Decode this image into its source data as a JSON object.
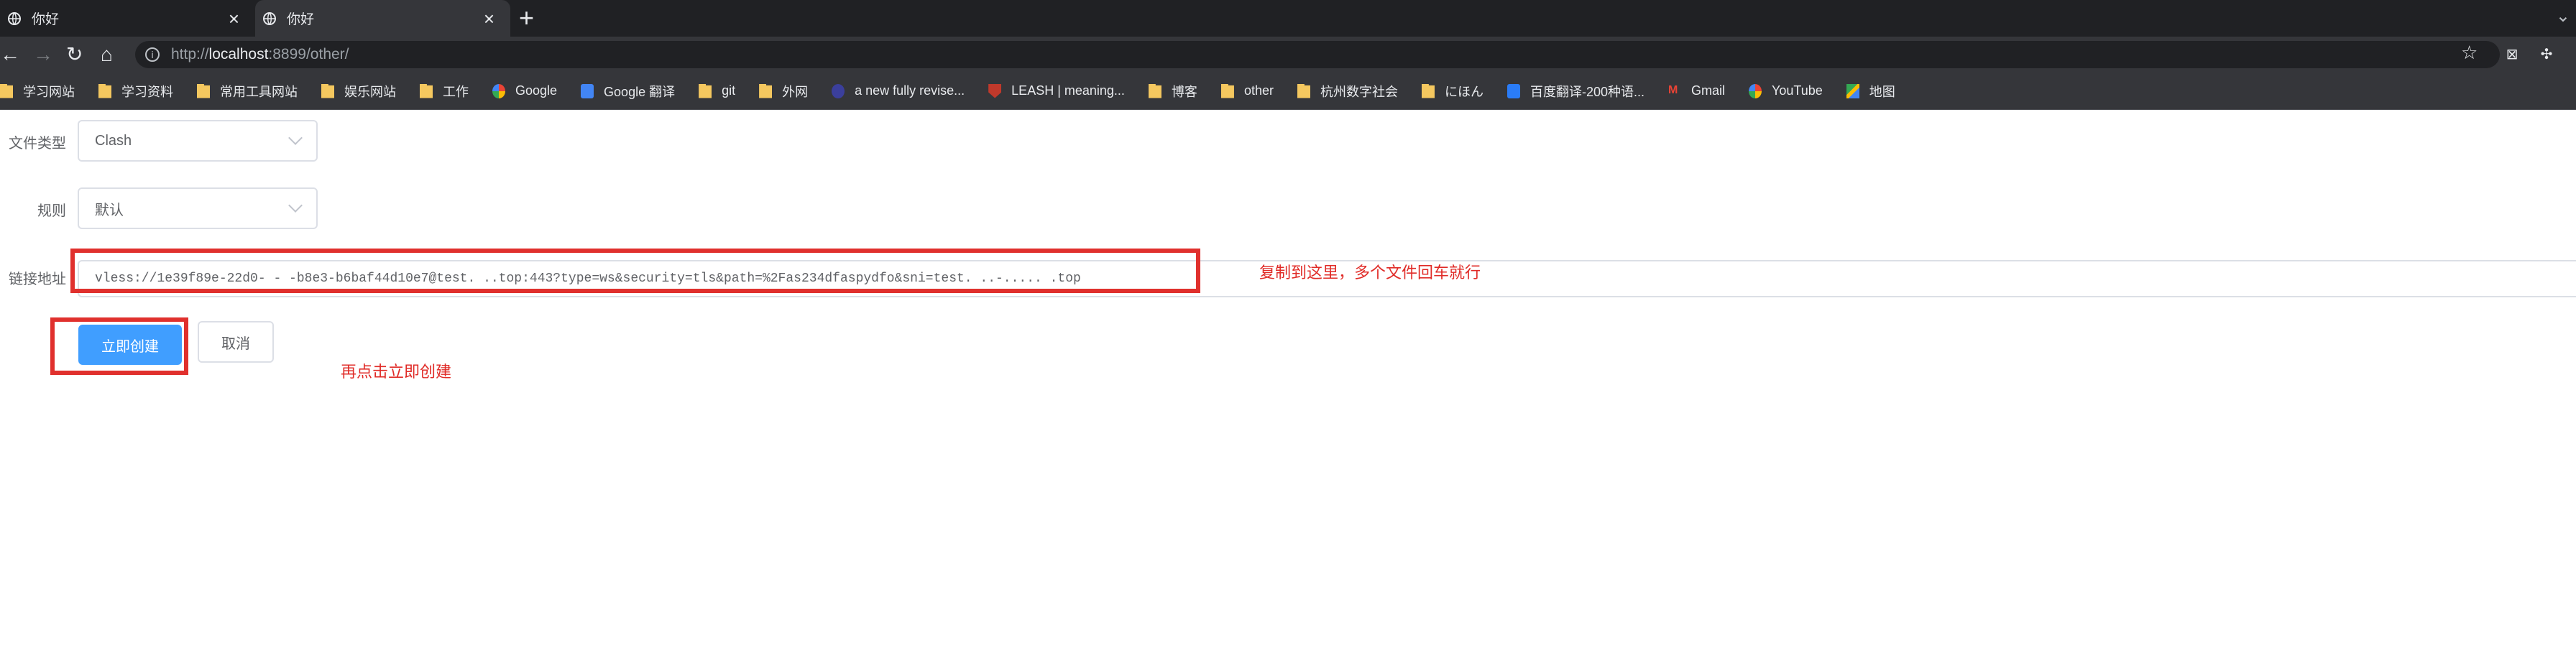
{
  "browser": {
    "tabs": [
      {
        "title": "你好",
        "active": false
      },
      {
        "title": "你好",
        "active": true
      }
    ],
    "url_prefix": "http://",
    "url_host": "localhost",
    "url_rest": ":8899/other/",
    "bookmarks": [
      {
        "label": "学习网站",
        "icon": "folder-icon"
      },
      {
        "label": "学习资料",
        "icon": "folder-icon"
      },
      {
        "label": "常用工具网站",
        "icon": "folder-icon"
      },
      {
        "label": "娱乐网站",
        "icon": "folder-icon"
      },
      {
        "label": "工作",
        "icon": "folder-icon"
      },
      {
        "label": "Google",
        "icon": "google-icon"
      },
      {
        "label": "Google 翻译",
        "icon": "google-translate-icon"
      },
      {
        "label": "git",
        "icon": "folder-icon"
      },
      {
        "label": "外网",
        "icon": "folder-icon"
      },
      {
        "label": "a new fully revise...",
        "icon": "site-icon"
      },
      {
        "label": "LEASH | meaning...",
        "icon": "shield-icon"
      },
      {
        "label": "博客",
        "icon": "folder-icon"
      },
      {
        "label": "other",
        "icon": "folder-icon"
      },
      {
        "label": "杭州数字社会",
        "icon": "folder-icon"
      },
      {
        "label": "にほん",
        "icon": "folder-icon"
      },
      {
        "label": "百度翻译-200种语...",
        "icon": "baidu-translate-icon"
      },
      {
        "label": "Gmail",
        "icon": "gmail-icon"
      },
      {
        "label": "YouTube",
        "icon": "google-icon"
      },
      {
        "label": "地图",
        "icon": "maps-icon"
      }
    ]
  },
  "form": {
    "file_type_label": "文件类型",
    "file_type_value": "Clash",
    "rule_label": "规则",
    "rule_value": "默认",
    "link_label": "链接地址",
    "link_value": "vless://1e39f89e-22d0-  -  -b8e3-b6baf44d10e7@test.          ..top:443?type=ws&security=tls&path=%2Fas234dfaspydfo&sni=test.   ..-.....  .top",
    "create_button": "立即创建",
    "cancel_button": "取消"
  },
  "annotations": {
    "paste_hint": "复制到这里，多个文件回车就行",
    "click_hint": "再点击立即创建",
    "highlight_color": "#e0302d"
  }
}
